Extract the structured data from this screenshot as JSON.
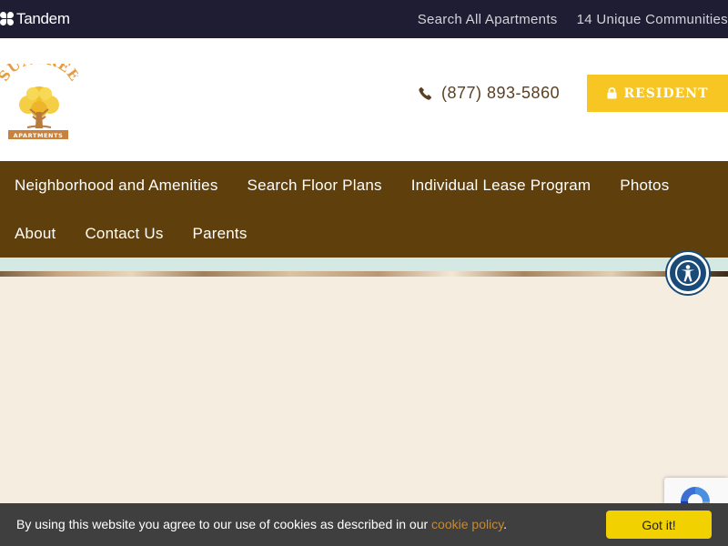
{
  "topbar": {
    "brand": "Tandem",
    "links": [
      "Search All Apartments",
      "14 Unique Communities"
    ]
  },
  "header": {
    "logo_text": "SUNTREE",
    "logo_subtext": "APARTMENTS",
    "phone": "(877) 893-5860",
    "resident_label": "RESIDENT"
  },
  "nav": {
    "row1": [
      "Neighborhood and Amenities",
      "Search Floor Plans",
      "Individual Lease Program",
      "Photos"
    ],
    "row2": [
      "About",
      "Contact Us",
      "Parents"
    ]
  },
  "cookie": {
    "text_before": "By using this website you agree to our use of cookies as described in our ",
    "link": "cookie policy",
    "text_after": ".",
    "button": "Got it!"
  },
  "icons": {
    "brand": "tandem-logo-icon",
    "phone": "phone-icon",
    "lock": "lock-icon",
    "accessibility": "accessibility-icon",
    "recaptcha": "recaptcha-icon"
  },
  "colors": {
    "topbar": "#1f1d33",
    "nav": "#5f3f0b",
    "resident_button": "#f7c623",
    "cookie_button": "#f1d100",
    "cookie_link": "#c88a31",
    "page_background": "#f5ede0",
    "accessibility": "#1a4a78"
  }
}
